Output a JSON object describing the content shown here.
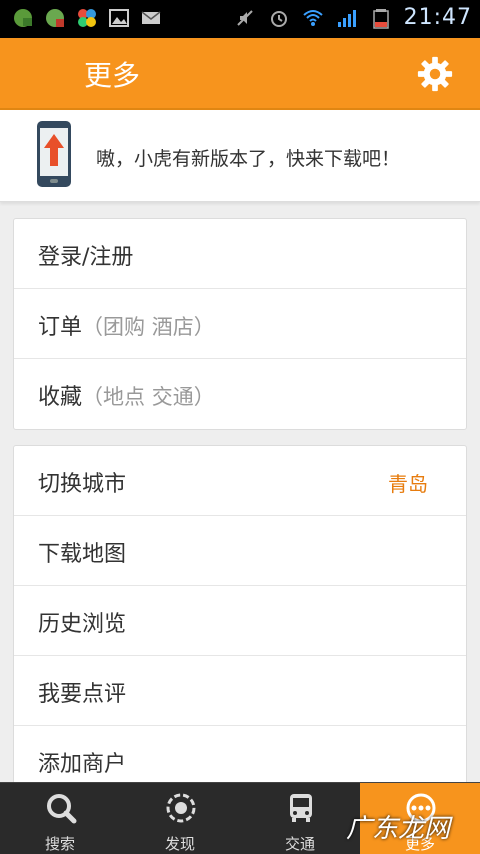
{
  "status_bar": {
    "time": "21:47",
    "icons": [
      "app-icon",
      "app-icon",
      "clover-icon",
      "image-icon",
      "mail-icon",
      "mute-icon",
      "alarm-icon",
      "wifi-icon",
      "signal-icon",
      "battery-icon"
    ]
  },
  "header": {
    "title": "更多",
    "settings_icon": "gear-icon"
  },
  "banner": {
    "icon": "phone-update-icon",
    "text": "嗷，小虎有新版本了，快来下载吧！"
  },
  "group1": {
    "login": "登录/注册",
    "orders": "订单",
    "orders_sub": "（团购  酒店）",
    "favorites": "收藏",
    "favorites_sub": "（地点  交通）"
  },
  "group2": {
    "switch_city": "切换城市",
    "current_city": "青岛",
    "download_map": "下载地图",
    "history": "历史浏览",
    "review": "我要点评",
    "add_merchant": "添加商户"
  },
  "bottom_nav": {
    "search": "搜索",
    "discover": "发现",
    "transport": "交通",
    "more": "更多"
  },
  "watermark": "广东龙网",
  "colors": {
    "accent": "#f7941d",
    "city": "#e77c0e",
    "nav_bg": "#2a2a2a"
  }
}
